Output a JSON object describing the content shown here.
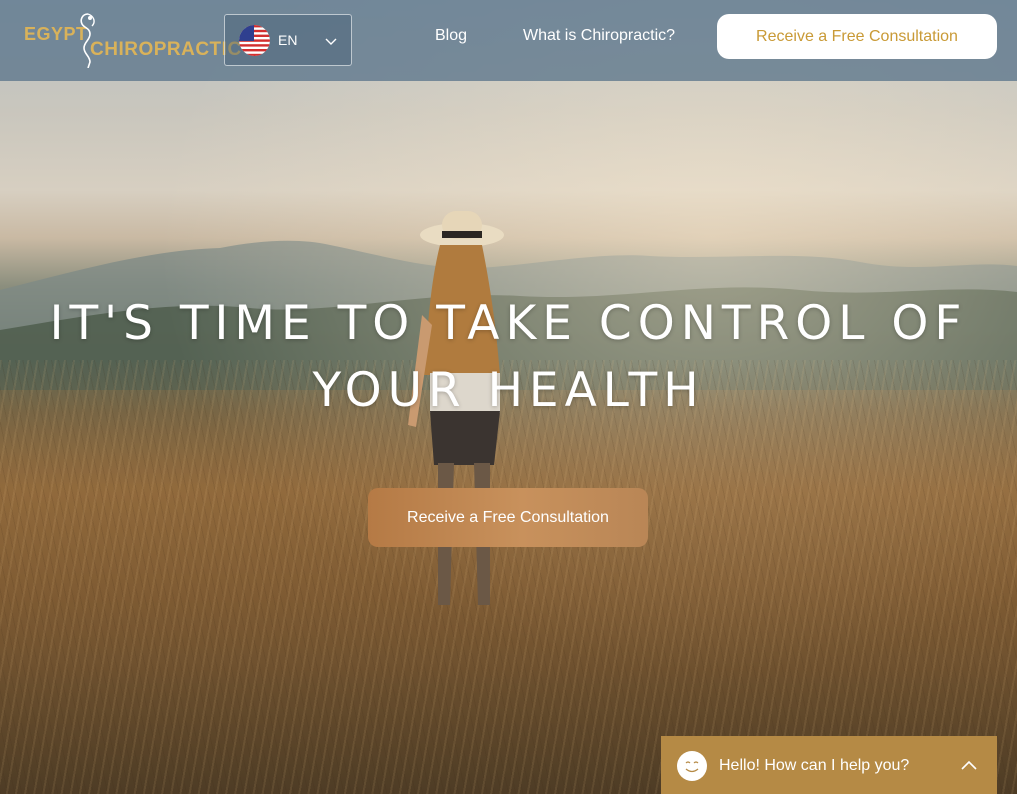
{
  "brand": {
    "line1": "EGYPT",
    "line2": "CHIROPRACTIC",
    "color": "#d9b25a",
    "icon": "spine-figure-icon"
  },
  "language": {
    "code": "EN",
    "flag_icon": "us-flag-icon",
    "dropdown_icon": "chevron-down-icon"
  },
  "nav": {
    "blog": "Blog",
    "what_is": "What is Chiropractic?",
    "cta": "Receive a Free Consultation"
  },
  "hero": {
    "headline": "IT'S TIME TO TAKE CONTROL OF YOUR HEALTH",
    "cta": "Receive a Free Consultation"
  },
  "chat": {
    "message": "Hello! How can I help you?",
    "avatar_icon": "smiley-face-icon",
    "expand_icon": "chevron-up-icon",
    "color": "#b58a45"
  },
  "colors": {
    "accent": "#c99a36",
    "header_bg": "#5c768c"
  }
}
